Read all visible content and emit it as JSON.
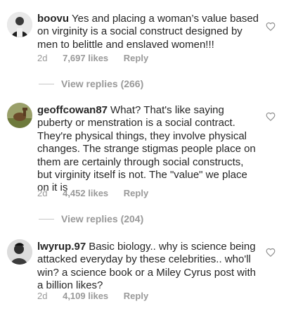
{
  "comments": [
    {
      "username": "boovu",
      "text": "Yes and placing a woman’s value based on virginity is a social construct designed by men to belittle and enslaved women!!!",
      "age": "2d",
      "likes": "7,697 likes",
      "reply_label": "Reply",
      "view_replies": "View replies (266)",
      "avatar_icon": "user-avatar-icon"
    },
    {
      "username": "geoffcowan87",
      "text": "What? That's like saying puberty or menstration is a social contract. They're physical things, they involve physical changes. The strange stigmas people place on them are certainly through social constructs, but virginity itself is not. The \"value\" we place on it is",
      "age": "2d",
      "likes": "4,452 likes",
      "reply_label": "Reply",
      "view_replies": "View replies (204)",
      "avatar_icon": "user-avatar-icon"
    },
    {
      "username": "lwyrup.97",
      "text": "Basic biology.. why is science being attacked everyday by these celebrities.. who'll win? a science book or a Miley Cyrus post with a billion likes?",
      "age": "2d",
      "likes": "4,109 likes",
      "reply_label": "Reply",
      "avatar_icon": "user-avatar-icon"
    }
  ],
  "colors": {
    "text": "#262626",
    "secondary": "#999999",
    "divider": "#c7c7c7",
    "heart": "#8e8e8e"
  }
}
